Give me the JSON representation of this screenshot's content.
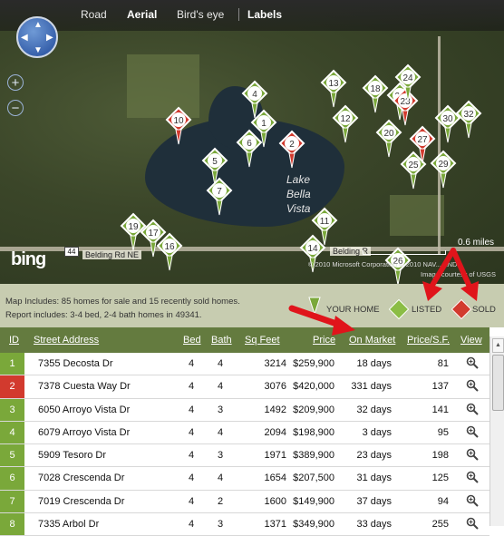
{
  "map": {
    "nav": [
      "Road",
      "Aerial",
      "Bird's eye",
      "Labels"
    ],
    "nav_active": "Aerial",
    "lake_label": [
      "Lake",
      "Bella",
      "Vista"
    ],
    "scale": "0.6 miles",
    "road_left": "Belding Rd NE",
    "road_shield": "44",
    "road_right": "Belding R",
    "copyright": "© 2010 Microsoft Corporation   © 2010 NAV... AND",
    "imagery": "Image courtesy of USGS",
    "brand": "bing",
    "pins": [
      {
        "id": "1",
        "status": "listed"
      },
      {
        "id": "2",
        "status": "sold"
      },
      {
        "id": "4",
        "status": "listed"
      },
      {
        "id": "5",
        "status": "listed"
      },
      {
        "id": "6",
        "status": "listed"
      },
      {
        "id": "7",
        "status": "listed"
      },
      {
        "id": "10",
        "status": "sold"
      },
      {
        "id": "11",
        "status": "listed"
      },
      {
        "id": "12",
        "status": "listed"
      },
      {
        "id": "13",
        "status": "listed"
      },
      {
        "id": "14",
        "status": "listed"
      },
      {
        "id": "16",
        "status": "listed"
      },
      {
        "id": "17",
        "status": "listed"
      },
      {
        "id": "18",
        "status": "listed"
      },
      {
        "id": "19",
        "status": "listed"
      },
      {
        "id": "20",
        "status": "listed"
      },
      {
        "id": "21",
        "status": "listed"
      },
      {
        "id": "23",
        "status": "sold"
      },
      {
        "id": "24",
        "status": "listed"
      },
      {
        "id": "25",
        "status": "listed"
      },
      {
        "id": "26",
        "status": "listed"
      },
      {
        "id": "27",
        "status": "sold"
      },
      {
        "id": "29",
        "status": "listed"
      },
      {
        "id": "30",
        "status": "listed"
      },
      {
        "id": "32",
        "status": "listed"
      }
    ]
  },
  "legend": {
    "line1": "Map Includes: 85 homes for sale and 15 recently sold homes.",
    "line2": "Report includes: 3-4 bed, 2-4 bath homes in 49341.",
    "your_home": "YOUR HOME",
    "listed": "LISTED",
    "sold": "SOLD"
  },
  "colors": {
    "listed": "#7aa83a",
    "sold": "#d23a2e",
    "header": "#647b3f",
    "legend_bg": "#c7ccb0",
    "arrow": "#e0141b"
  },
  "table": {
    "headers": {
      "id": "ID",
      "street": "Street Address",
      "bed": "Bed",
      "bath": "Bath",
      "sqft": "Sq Feet",
      "price": "Price",
      "market": "On Market",
      "ppsf": "Price/S.F.",
      "view": "View"
    },
    "rows": [
      {
        "id": "1",
        "status": "listed",
        "street": "7355 Decosta Dr",
        "bed": "4",
        "bath": "4",
        "sqft": "3214",
        "price": "$259,900",
        "market": "18 days",
        "ppsf": "81"
      },
      {
        "id": "2",
        "status": "sold",
        "street": "7378 Cuesta Way Dr",
        "bed": "4",
        "bath": "4",
        "sqft": "3076",
        "price": "$420,000",
        "market": "331 days",
        "ppsf": "137"
      },
      {
        "id": "3",
        "status": "listed",
        "street": "6050 Arroyo Vista Dr",
        "bed": "4",
        "bath": "3",
        "sqft": "1492",
        "price": "$209,900",
        "market": "32 days",
        "ppsf": "141"
      },
      {
        "id": "4",
        "status": "listed",
        "street": "6079 Arroyo Vista Dr",
        "bed": "4",
        "bath": "4",
        "sqft": "2094",
        "price": "$198,900",
        "market": "3 days",
        "ppsf": "95"
      },
      {
        "id": "5",
        "status": "listed",
        "street": "5909 Tesoro Dr",
        "bed": "4",
        "bath": "3",
        "sqft": "1971",
        "price": "$389,900",
        "market": "23 days",
        "ppsf": "198"
      },
      {
        "id": "6",
        "status": "listed",
        "street": "7028 Crescenda Dr",
        "bed": "4",
        "bath": "4",
        "sqft": "1654",
        "price": "$207,500",
        "market": "31 days",
        "ppsf": "125"
      },
      {
        "id": "7",
        "status": "listed",
        "street": "7019 Crescenda Dr",
        "bed": "4",
        "bath": "2",
        "sqft": "1600",
        "price": "$149,900",
        "market": "37 days",
        "ppsf": "94"
      },
      {
        "id": "8",
        "status": "listed",
        "street": "7335 Arbol Dr",
        "bed": "4",
        "bath": "3",
        "sqft": "1371",
        "price": "$349,900",
        "market": "33 days",
        "ppsf": "255"
      }
    ]
  }
}
